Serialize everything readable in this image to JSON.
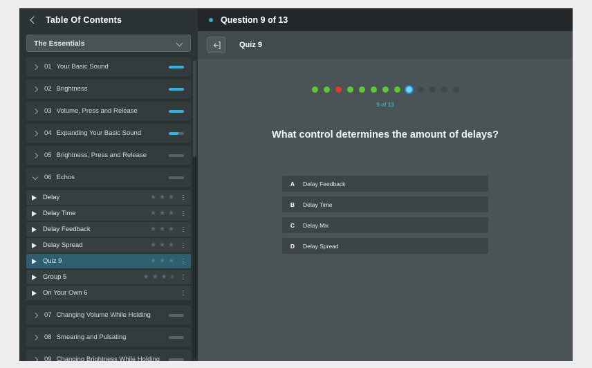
{
  "sidebar": {
    "back_icon": "chevron-left-icon",
    "title": "Table Of Contents",
    "course_select": {
      "value": "The Essentials",
      "chevron": "chevron-down-icon"
    },
    "chapters": [
      {
        "num": "01",
        "name": "Your Basic Sound",
        "progress": 100,
        "expanded": false
      },
      {
        "num": "02",
        "name": "Brightness",
        "progress": 100,
        "expanded": false
      },
      {
        "num": "03",
        "name": "Volume, Press and Release",
        "progress": 100,
        "expanded": false
      },
      {
        "num": "04",
        "name": "Expanding Your Basic Sound",
        "progress": 65,
        "expanded": false
      },
      {
        "num": "05",
        "name": "Brightness, Press and Release",
        "progress": 0,
        "expanded": false
      },
      {
        "num": "06",
        "name": "Echos",
        "progress": 0,
        "expanded": true
      },
      {
        "num": "07",
        "name": "Changing Volume While Holding",
        "progress": 0,
        "expanded": false
      },
      {
        "num": "08",
        "name": "Smearing and Pulsating",
        "progress": 0,
        "expanded": false
      },
      {
        "num": "09",
        "name": "Changing Brightness While Holding",
        "progress": 0,
        "expanded": false
      }
    ],
    "lessons": [
      {
        "name": "Delay",
        "stars": 3,
        "plus": false,
        "selected": false
      },
      {
        "name": "Delay Time",
        "stars": 3,
        "plus": false,
        "selected": false
      },
      {
        "name": "Delay Feedback",
        "stars": 3,
        "plus": false,
        "selected": false
      },
      {
        "name": "Delay Spread",
        "stars": 3,
        "plus": false,
        "selected": false
      },
      {
        "name": "Quiz 9",
        "stars": 3,
        "plus": false,
        "selected": true
      },
      {
        "name": "Group 5",
        "stars": 3,
        "plus": true,
        "selected": false
      },
      {
        "name": "On Your Own 6",
        "stars": 0,
        "plus": false,
        "selected": false
      }
    ],
    "star_glyph": "★",
    "plus_glyph": "+"
  },
  "main": {
    "topbar": {
      "status_dot_color": "#3fa9c9",
      "title": "Question 9 of 13"
    },
    "subbar": {
      "exit_icon": "exit-arrow-icon",
      "quiz_title": "Quiz 9"
    },
    "quiz": {
      "progress_dots": [
        "correct",
        "correct",
        "wrong",
        "correct",
        "correct",
        "correct",
        "correct",
        "correct",
        "current",
        "pending",
        "pending",
        "pending",
        "pending"
      ],
      "dots_caption": "9 of 13",
      "question": "What control determines the amount of delays?",
      "answers": [
        {
          "key": "A",
          "text": "Delay Feedback"
        },
        {
          "key": "B",
          "text": "Delay Time"
        },
        {
          "key": "C",
          "text": "Delay Mix"
        },
        {
          "key": "D",
          "text": "Delay Spread"
        }
      ]
    }
  },
  "colors": {
    "accent_teal": "#3fa9c9",
    "progress_cyan": "#31b4e8",
    "correct_green": "#5bc832",
    "wrong_red": "#e03b2b",
    "selected_row": "#2d5f70"
  }
}
